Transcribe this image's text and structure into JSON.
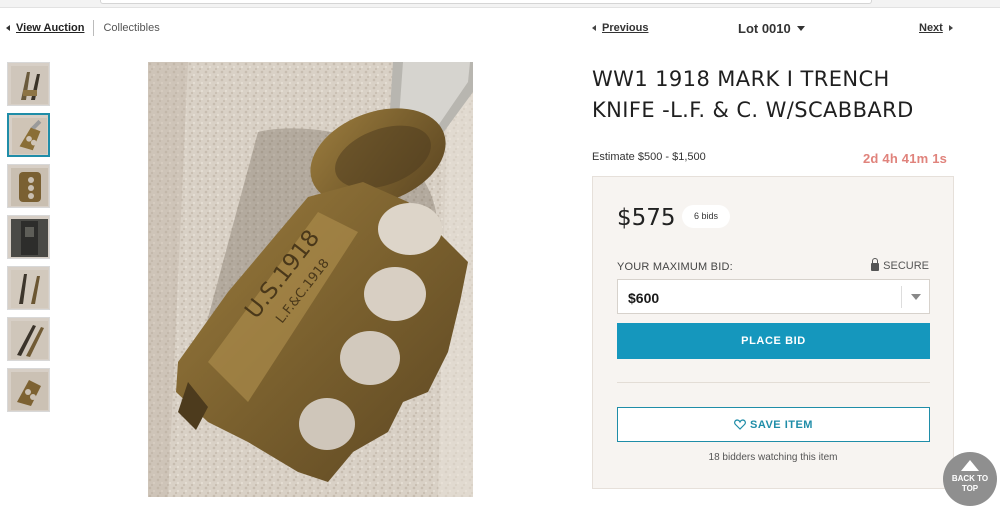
{
  "nav": {
    "back_label": "View Auction",
    "category": "Collectibles",
    "previous_label": "Previous",
    "lot_label": "Lot 0010",
    "next_label": "Next"
  },
  "thumbnails": [
    {
      "name": "thumbnail-1",
      "active": false
    },
    {
      "name": "thumbnail-2",
      "active": true
    },
    {
      "name": "thumbnail-3",
      "active": false
    },
    {
      "name": "thumbnail-4",
      "active": false
    },
    {
      "name": "thumbnail-5",
      "active": false
    },
    {
      "name": "thumbnail-6",
      "active": false
    },
    {
      "name": "thumbnail-7",
      "active": false
    }
  ],
  "item": {
    "title": "WW1 1918 MARK I TRENCH KNIFE -L.F. & C. W/SCABBARD",
    "estimate": "Estimate $500 - $1,500",
    "time_left": "2d 4h 41m 1s",
    "photo_text_1": "U.S.1918",
    "photo_text_2": "L.F.&C.1918"
  },
  "bid": {
    "current_price": "$575",
    "bid_count": "6 bids",
    "max_bid_label": "YOUR MAXIMUM BID:",
    "secure_label": "SECURE",
    "selected_bid": "$600",
    "place_bid_label": "PLACE BID",
    "save_item_label": "SAVE ITEM",
    "watching_text": "18 bidders watching this item"
  },
  "back_to_top": {
    "line1": "BACK TO",
    "line2": "TOP"
  },
  "colors": {
    "accent": "#1597bd",
    "countdown": "#e0837c",
    "panel_bg": "#f7f4f1"
  }
}
